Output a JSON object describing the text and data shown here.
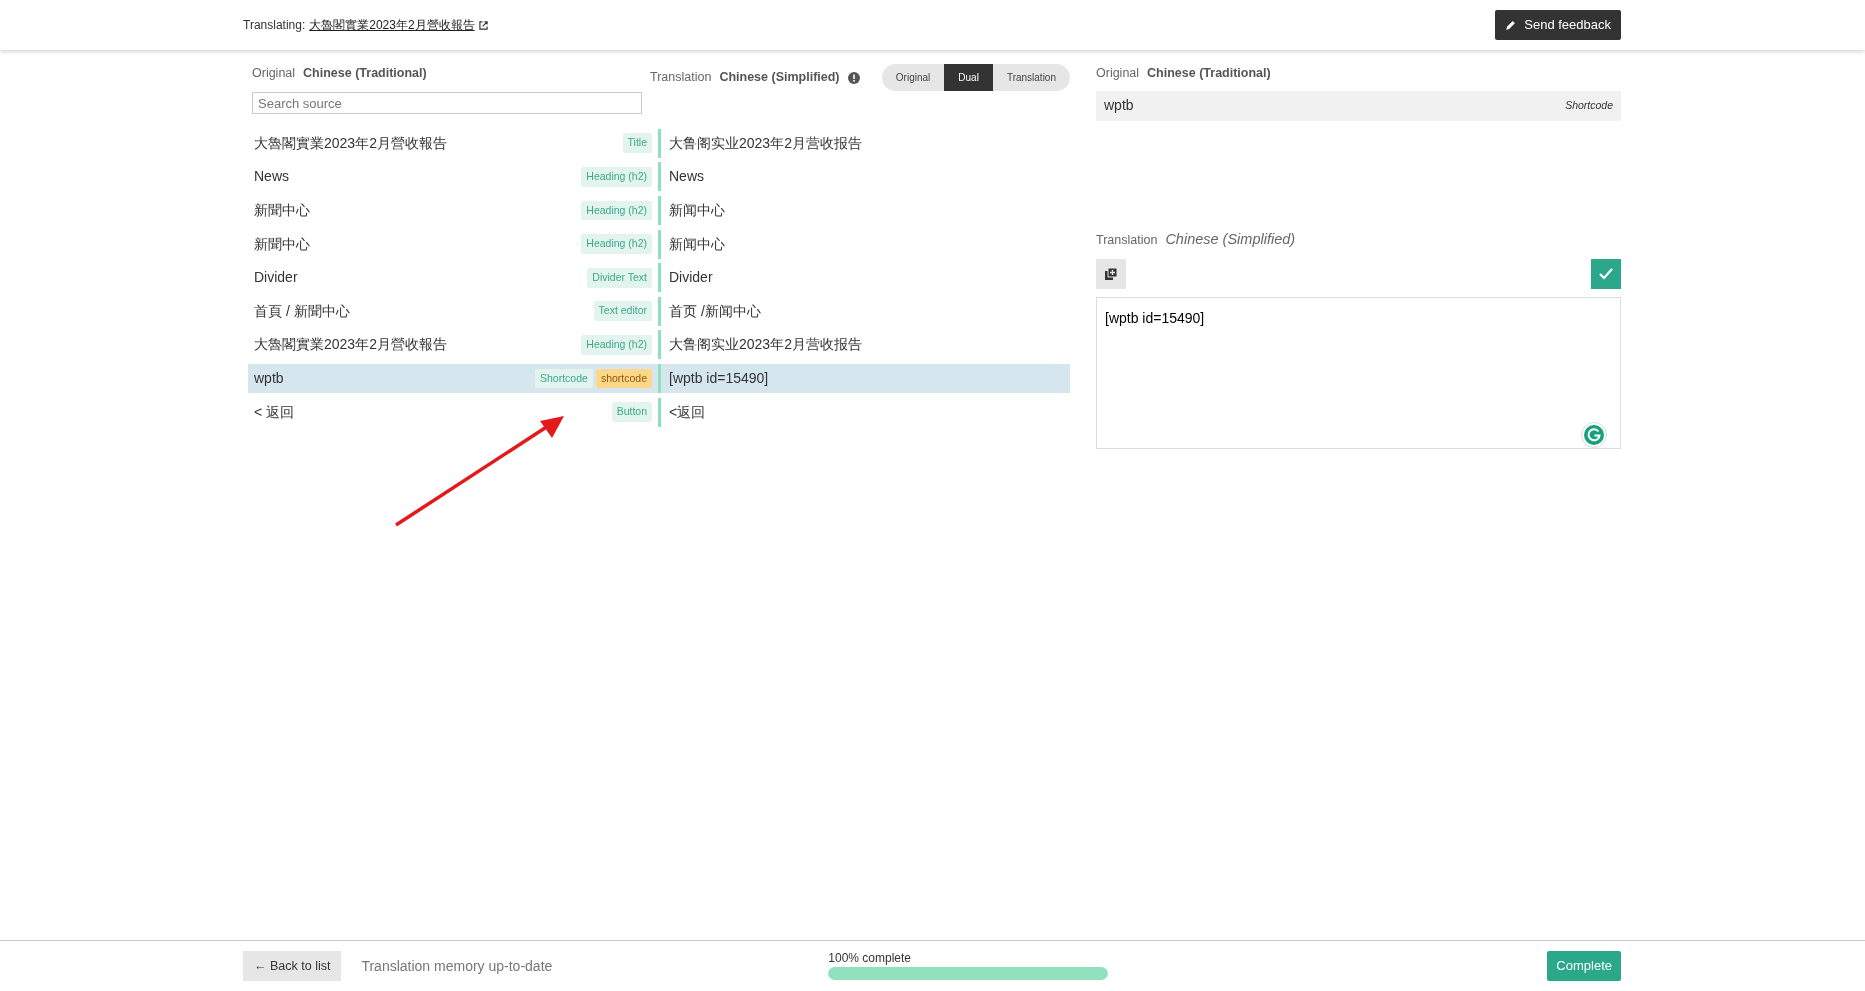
{
  "header": {
    "label": "Translating:",
    "page_link": "大魯閣實業2023年2月營收報告",
    "feedback_button": "Send feedback"
  },
  "source_column": {
    "label": "Original",
    "language": "Chinese (Traditional)",
    "search": {
      "placeholder": "Search source"
    }
  },
  "translation_column": {
    "label": "Translation",
    "language": "Chinese (Simplified)"
  },
  "view_toggle": [
    {
      "label": "Original",
      "selected": false
    },
    {
      "label": "Dual",
      "selected": true
    },
    {
      "label": "Translation",
      "selected": false
    }
  ],
  "rows": [
    {
      "source": "大魯閣實業2023年2月營收報告",
      "tags": [
        {
          "text": "Title",
          "kind": "type"
        }
      ],
      "translation": "大鲁阁实业2023年2月营收报告",
      "selected": false
    },
    {
      "source": "News",
      "tags": [
        {
          "text": "Heading (h2)",
          "kind": "type"
        }
      ],
      "translation": "News",
      "selected": false
    },
    {
      "source": "新聞中心",
      "tags": [
        {
          "text": "Heading (h2)",
          "kind": "type"
        }
      ],
      "translation": "新闻中心",
      "selected": false
    },
    {
      "source": "新聞中心",
      "tags": [
        {
          "text": "Heading (h2)",
          "kind": "type"
        }
      ],
      "translation": "新闻中心",
      "selected": false
    },
    {
      "source": "Divider",
      "tags": [
        {
          "text": "Divider Text",
          "kind": "type"
        }
      ],
      "translation": "Divider",
      "selected": false
    },
    {
      "source": "首頁 / 新聞中心",
      "tags": [
        {
          "text": "Text editor",
          "kind": "type"
        }
      ],
      "translation": "首页 /新闻中心",
      "selected": false
    },
    {
      "source": "大魯閣實業2023年2月營收報告",
      "tags": [
        {
          "text": "Heading (h2)",
          "kind": "type"
        }
      ],
      "translation": "大鲁阁实业2023年2月营收报告",
      "selected": false
    },
    {
      "source": "wptb",
      "tags": [
        {
          "text": "Shortcode",
          "kind": "type"
        },
        {
          "text": "shortcode",
          "kind": "shortcode"
        }
      ],
      "translation": "[wptb id=15490]",
      "selected": true
    },
    {
      "source": "< 返回",
      "tags": [
        {
          "text": "Button",
          "kind": "type"
        }
      ],
      "translation": "<返回",
      "selected": false
    }
  ],
  "editor": {
    "original_label": "Original",
    "original_language": "Chinese (Traditional)",
    "original_text": "wptb",
    "original_type": "Shortcode",
    "translation_label": "Translation",
    "translation_language": "Chinese (Simplified)",
    "translation_value": "[wptb id=15490]"
  },
  "footer": {
    "back_button": "← Back to list",
    "memory_status": "Translation memory up-to-date",
    "progress_label": "100% complete",
    "progress": {
      "level": 1.0
    },
    "complete_button": "Complete"
  }
}
